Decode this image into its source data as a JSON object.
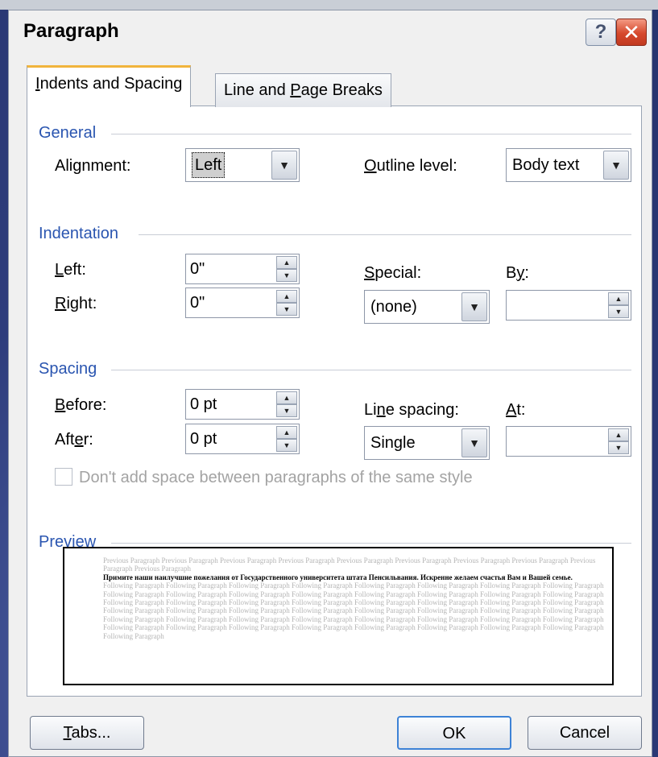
{
  "window": {
    "title": "Paragraph",
    "help_glyph": "?",
    "close_glyph": "✕"
  },
  "tabs": [
    {
      "label_underlined": "I",
      "label_rest": "ndents and Spacing",
      "active": true
    },
    {
      "label_before": "Line and ",
      "label_underlined": "P",
      "label_after": "age Breaks",
      "active": false
    }
  ],
  "general": {
    "heading": "General",
    "alignment_label": "Alignment:",
    "alignment_value": "Left",
    "outline_label_underlined": "O",
    "outline_label_rest": "utline level:",
    "outline_value": "Body text"
  },
  "indentation": {
    "heading": "Indentation",
    "left_label_underlined": "L",
    "left_label_rest": "eft:",
    "left_value": "0\"",
    "right_label_underlined": "R",
    "right_label_rest": "ight:",
    "right_value": "0\"",
    "special_label_underlined": "S",
    "special_label_rest": "pecial:",
    "special_value": "(none)",
    "by_label_before": "B",
    "by_label_underlined": "y",
    "by_label_after": ":",
    "by_value": ""
  },
  "spacing": {
    "heading": "Spacing",
    "before_label_underlined": "B",
    "before_label_rest": "efore:",
    "before_value": "0 pt",
    "after_label_before": "Aft",
    "after_label_underlined": "e",
    "after_label_after": "r:",
    "after_value": "0 pt",
    "line_spacing_label_before": "Li",
    "line_spacing_label_underlined": "n",
    "line_spacing_label_after": "e spacing:",
    "line_spacing_value": "Single",
    "at_label_underlined": "A",
    "at_label_rest": "t:",
    "at_value": "",
    "dont_add_space_label": "Don't add space between paragraphs of the same style",
    "dont_add_space_checked": false
  },
  "preview": {
    "heading": "Preview",
    "previous_text": "Previous Paragraph Previous Paragraph Previous Paragraph Previous Paragraph Previous Paragraph Previous Paragraph Previous Paragraph Previous Paragraph Previous Paragraph Previous Paragraph",
    "current_text": "Примите наши наилучшие пожелания от Государственного университета штата Пенсильвания. Искренне желаем счастья Вам и Вашей семье.",
    "following_text": "Following Paragraph Following Paragraph Following Paragraph Following Paragraph Following Paragraph Following Paragraph Following Paragraph Following Paragraph Following Paragraph Following Paragraph Following Paragraph Following Paragraph Following Paragraph Following Paragraph Following Paragraph Following Paragraph Following Paragraph Following Paragraph Following Paragraph Following Paragraph Following Paragraph Following Paragraph Following Paragraph Following Paragraph Following Paragraph Following Paragraph Following Paragraph Following Paragraph Following Paragraph Following Paragraph Following Paragraph Following Paragraph Following Paragraph Following Paragraph Following Paragraph Following Paragraph Following Paragraph Following Paragraph Following Paragraph Following Paragraph Following Paragraph Following Paragraph Following Paragraph Following Paragraph Following Paragraph Following Paragraph Following Paragraph Following Paragraph Following Paragraph"
  },
  "buttons": {
    "tabs_underlined": "T",
    "tabs_rest": "abs...",
    "ok_label": "OK",
    "cancel_label": "Cancel"
  },
  "icons": {
    "dropdown_arrow": "▼",
    "spin_up": "▲",
    "spin_down": "▼"
  }
}
